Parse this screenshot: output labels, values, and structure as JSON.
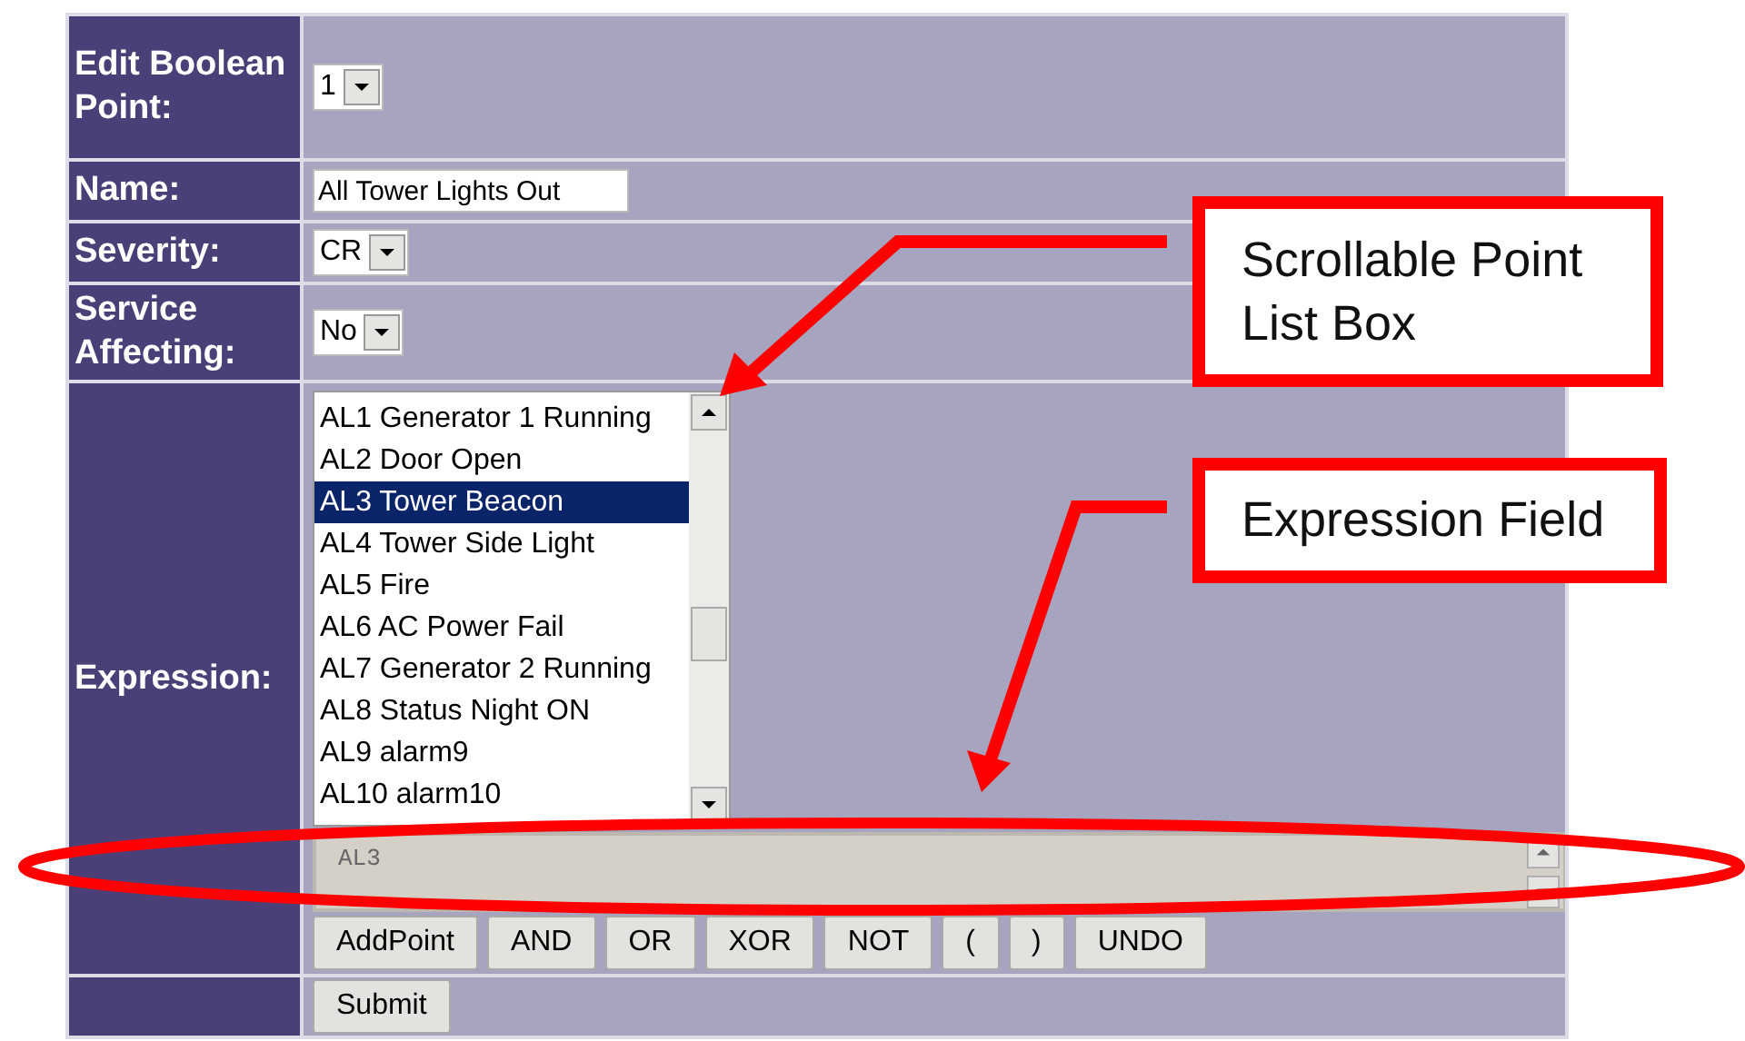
{
  "form": {
    "point": {
      "label": "Edit Boolean Point:",
      "value": "1"
    },
    "name": {
      "label": "Name:",
      "value": "All Tower Lights Out"
    },
    "severity": {
      "label": "Severity:",
      "value": "CR"
    },
    "service": {
      "label": "Service Affecting:",
      "value": "No"
    },
    "expression": {
      "label": "Expression:",
      "points": [
        {
          "text": "AL1 Generator 1 Running",
          "selected": false
        },
        {
          "text": "AL2 Door Open",
          "selected": false
        },
        {
          "text": "AL3 Tower Beacon",
          "selected": true
        },
        {
          "text": "AL4 Tower Side Light",
          "selected": false
        },
        {
          "text": "AL5 Fire",
          "selected": false
        },
        {
          "text": "AL6 AC Power Fail",
          "selected": false
        },
        {
          "text": "AL7 Generator 2 Running",
          "selected": false
        },
        {
          "text": "AL8 Status Night ON",
          "selected": false
        },
        {
          "text": "AL9 alarm9",
          "selected": false
        },
        {
          "text": "AL10 alarm10",
          "selected": false
        }
      ],
      "value": "AL3",
      "buttons": [
        "AddPoint",
        "AND",
        "OR",
        "XOR",
        "NOT",
        "(",
        ")",
        "UNDO"
      ]
    },
    "submit": "Submit"
  },
  "callouts": [
    "Scrollable Point List Box",
    "Expression Field"
  ]
}
